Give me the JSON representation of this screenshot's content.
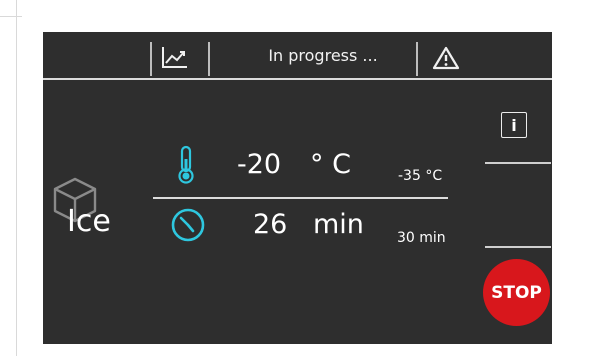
{
  "header": {
    "status": "In progress ..."
  },
  "mode": {
    "label": "Ice"
  },
  "temperature": {
    "value": "-20",
    "unit": "° C",
    "target": "-35 °C"
  },
  "time": {
    "value": "26",
    "unit": "min",
    "target": "30 min"
  },
  "buttons": {
    "stop_label": "STOP",
    "info_label": "i"
  },
  "colors": {
    "accent": "#2ec7df",
    "stop": "#d8171c",
    "background": "#2e2e2e"
  },
  "icons": [
    "chart-icon",
    "warning-icon",
    "info-icon",
    "thermometer-icon",
    "clock-icon",
    "cube-icon"
  ]
}
